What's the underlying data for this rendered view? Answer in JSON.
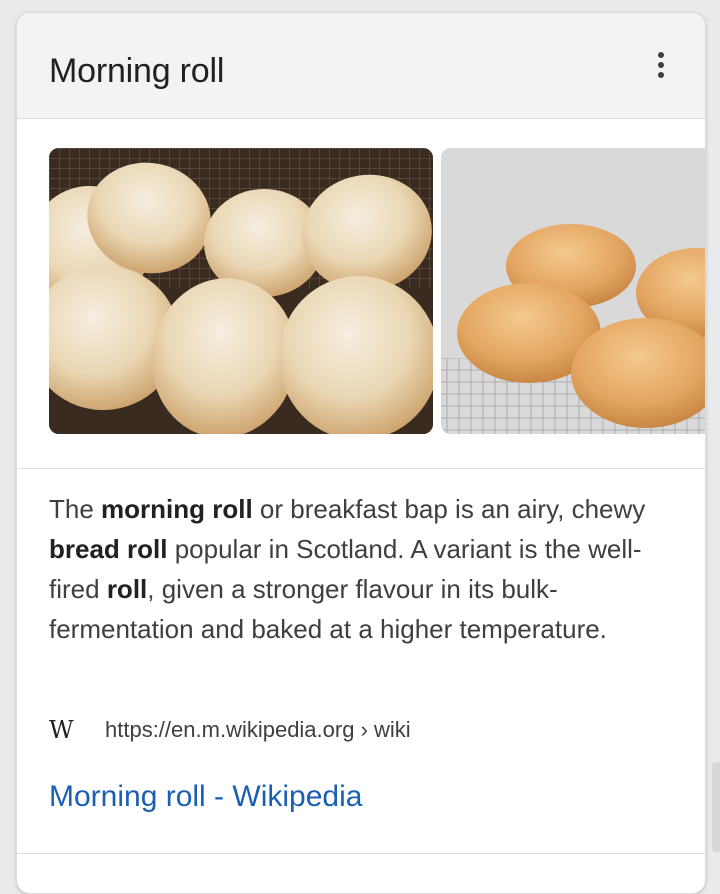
{
  "card": {
    "title": "Morning roll",
    "more_icon": "more-vert-icon"
  },
  "images": [
    {
      "alt": "Morning roll",
      "name": "image-1"
    },
    {
      "alt": "Morning roll",
      "name": "image-2"
    }
  ],
  "description": {
    "t1": "The ",
    "b1": "morning roll",
    "t2": " or breakfast bap is an airy, chewy ",
    "b2": "bread roll",
    "t3": " popular in Scotland. A variant is the well-fired ",
    "b3": "roll",
    "t4": ", given a stronger flavour in its bulk-fermentation and baked at a higher temperature."
  },
  "source": {
    "icon": "wikipedia-icon",
    "icon_text": "W",
    "url": "https://en.m.wikipedia.org › wiki"
  },
  "link": {
    "label": "Morning roll - Wikipedia"
  },
  "colors": {
    "link": "#1a5fb4",
    "header_bg": "#f1f3f4"
  }
}
